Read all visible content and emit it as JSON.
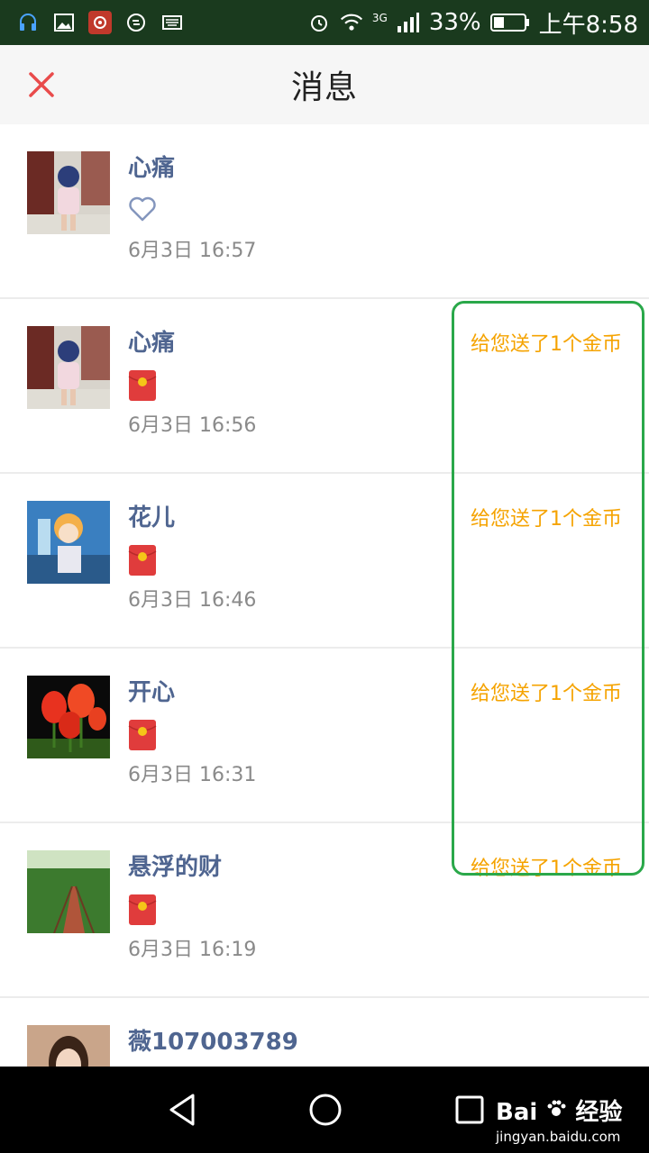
{
  "status_bar": {
    "network": "3G",
    "battery": "33%",
    "time": "上午8:58"
  },
  "header": {
    "title": "消息"
  },
  "messages": [
    {
      "name": "心痛",
      "type": "like",
      "time": "6月3日 16:57",
      "gift": ""
    },
    {
      "name": "心痛",
      "type": "redpacket",
      "time": "6月3日 16:56",
      "gift": "给您送了1个金币"
    },
    {
      "name": "花儿",
      "type": "redpacket",
      "time": "6月3日 16:46",
      "gift": "给您送了1个金币"
    },
    {
      "name": "开心",
      "type": "redpacket",
      "time": "6月3日 16:31",
      "gift": "给您送了1个金币"
    },
    {
      "name": "悬浮的财",
      "type": "redpacket",
      "time": "6月3日 16:19",
      "gift": "给您送了1个金币"
    },
    {
      "name": "薇107003789",
      "type": "like",
      "time": "",
      "gift": ""
    }
  ],
  "watermark": {
    "brand": "Bai",
    "brand_cn": "经验",
    "url": "jingyan.baidu.com"
  },
  "colors": {
    "accent": "#f5a300",
    "close": "#e94b4b",
    "name": "#4f6590",
    "highlight": "#2aa84a"
  }
}
